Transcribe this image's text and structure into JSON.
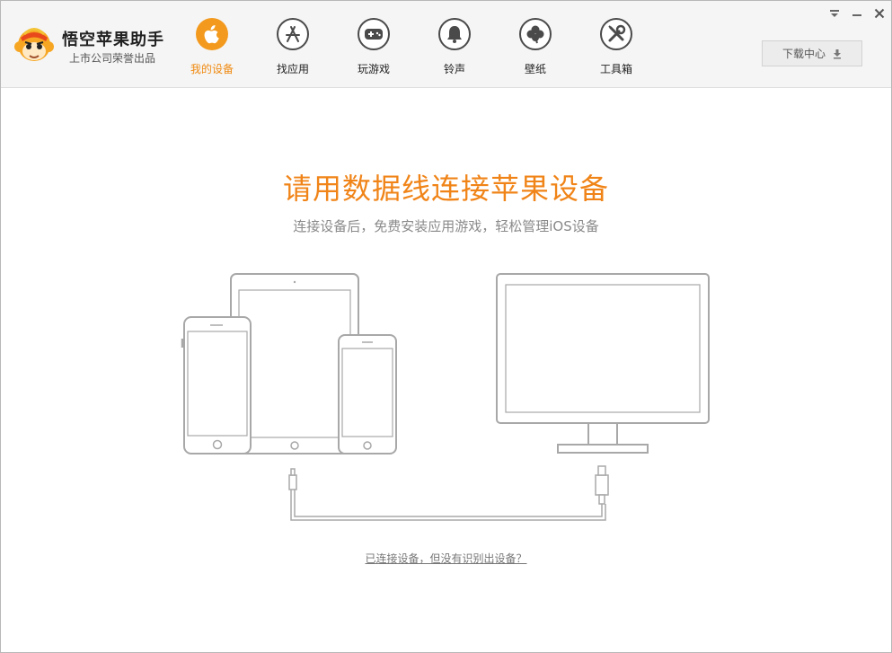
{
  "app": {
    "title": "悟空苹果助手",
    "subtitle": "上市公司荣誉出品"
  },
  "nav": {
    "items": [
      {
        "label": "我的设备",
        "icon": "apple-icon",
        "active": true
      },
      {
        "label": "找应用",
        "icon": "app-store-icon",
        "active": false
      },
      {
        "label": "玩游戏",
        "icon": "gamepad-icon",
        "active": false
      },
      {
        "label": "铃声",
        "icon": "bell-icon",
        "active": false
      },
      {
        "label": "壁纸",
        "icon": "clover-icon",
        "active": false
      },
      {
        "label": "工具箱",
        "icon": "tools-icon",
        "active": false
      }
    ]
  },
  "toolbar": {
    "download_label": "下载中心"
  },
  "main": {
    "headline": "请用数据线连接苹果设备",
    "subline": "连接设备后，免费安装应用游戏，轻松管理iOS设备",
    "help_link": "已连接设备，但没有识别出设备？"
  },
  "colors": {
    "accent": "#f39a1e",
    "headline": "#f08418",
    "icon_stroke": "#4a4a4a",
    "device_stroke": "#a8a8a8"
  }
}
